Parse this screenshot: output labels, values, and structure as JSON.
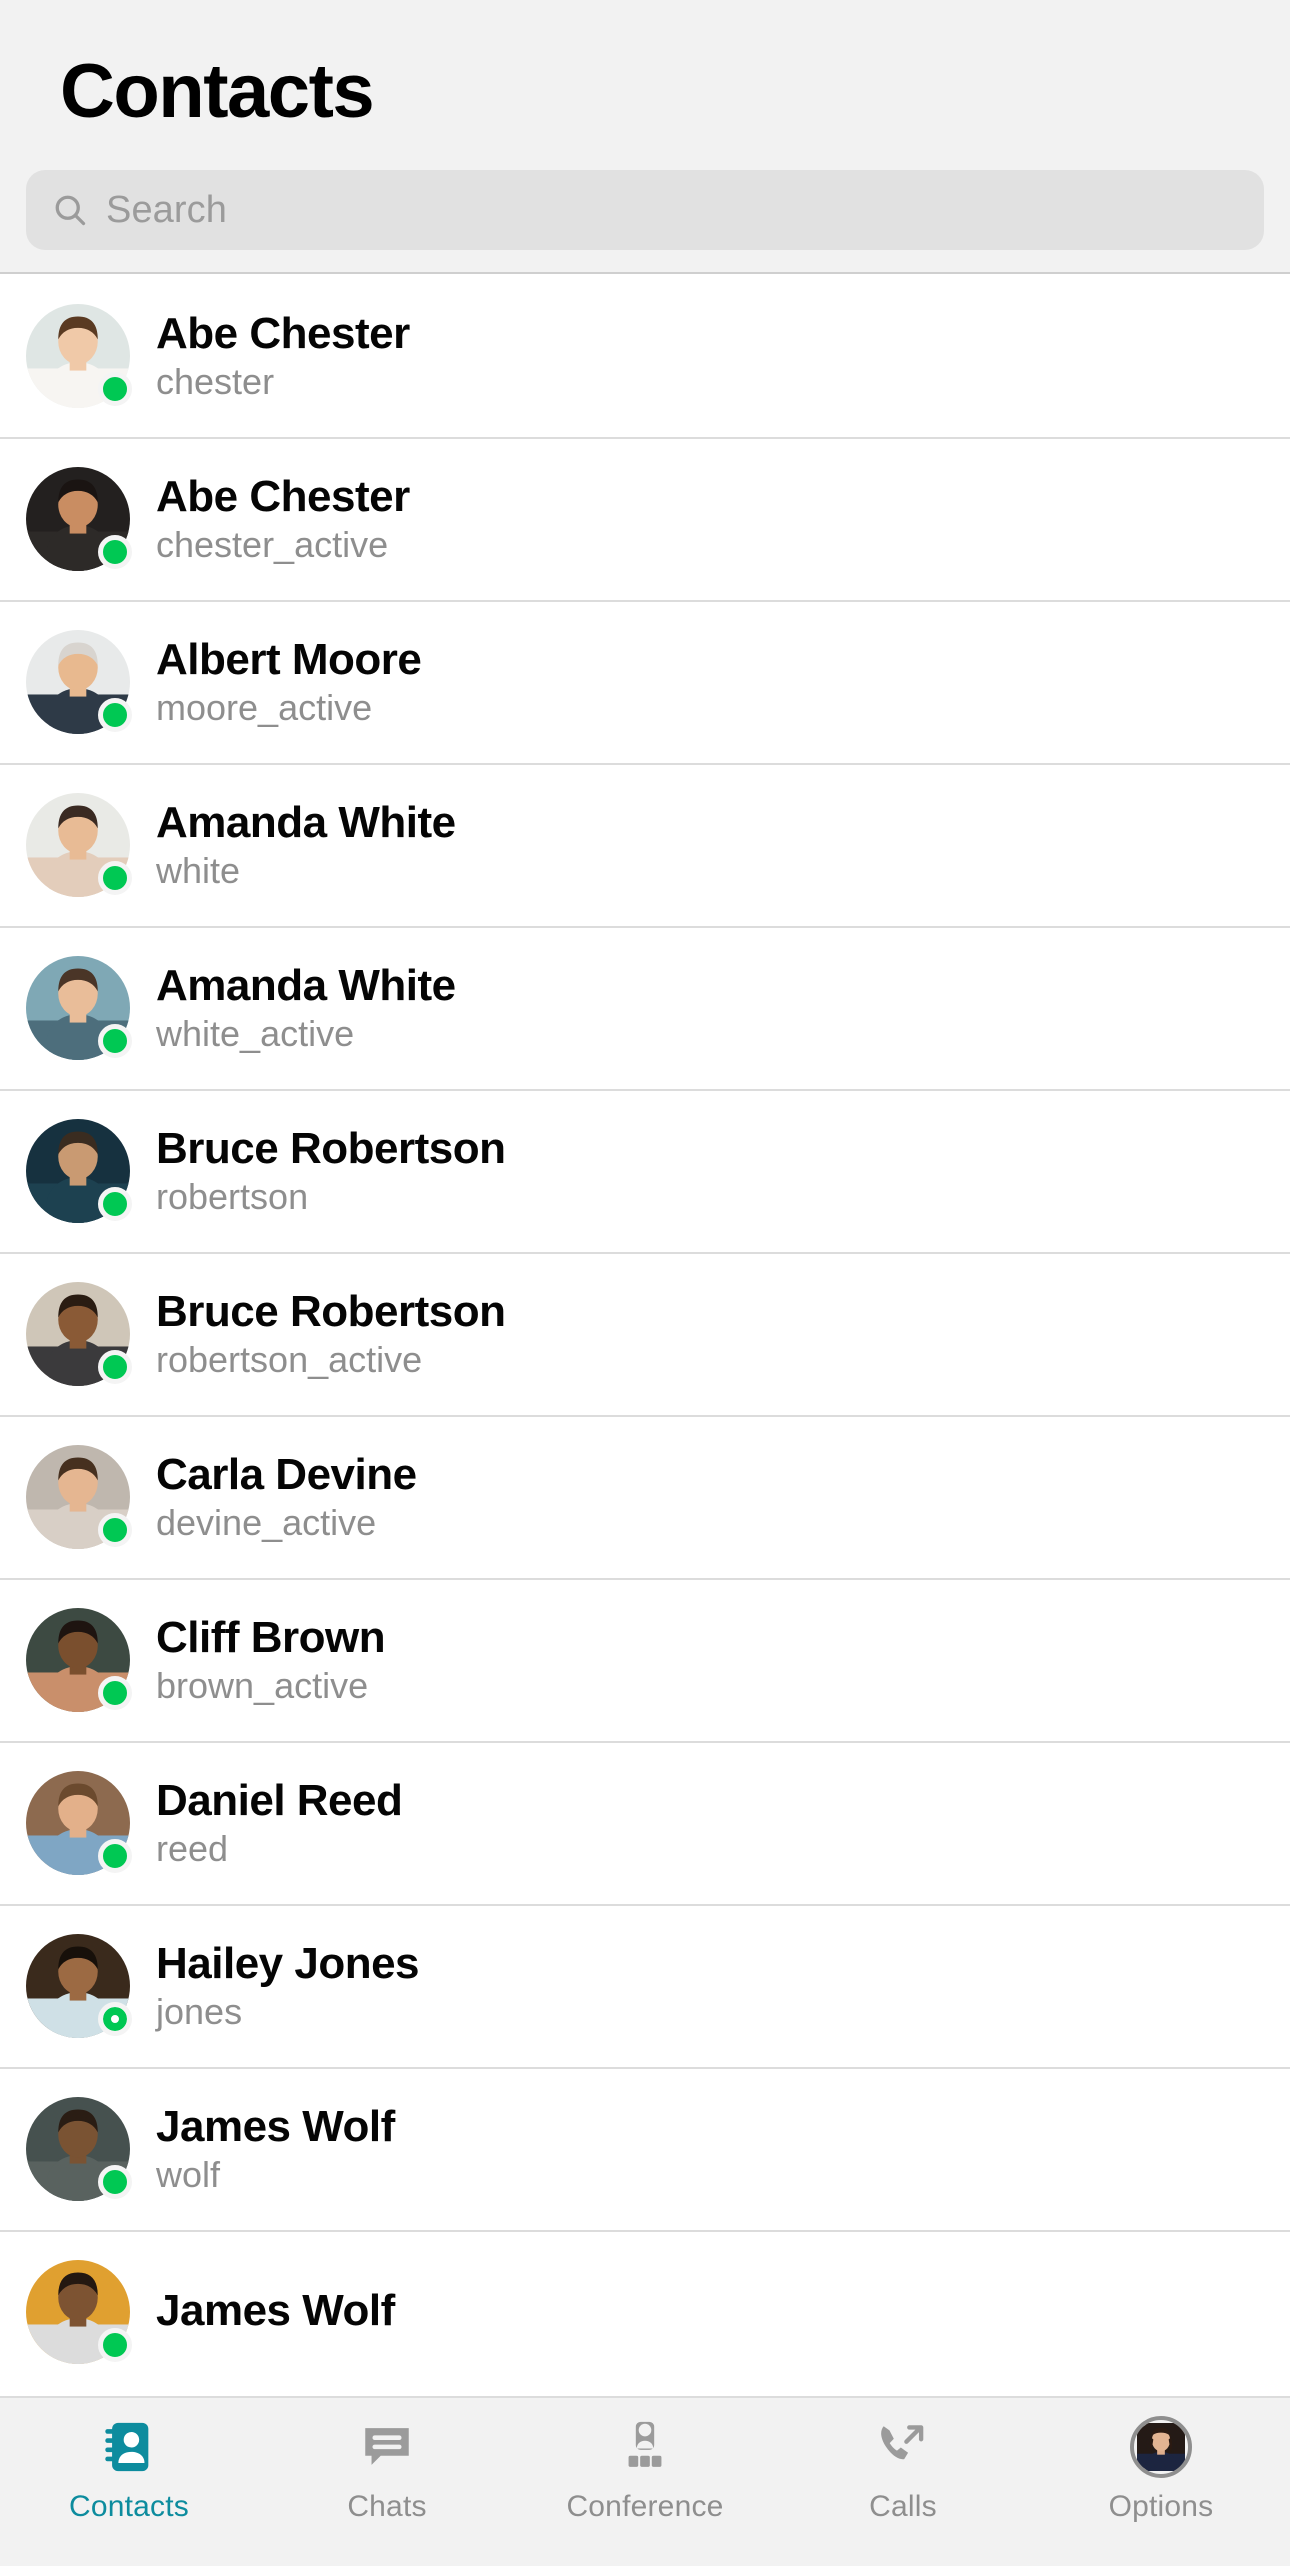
{
  "header": {
    "title": "Contacts",
    "search": {
      "placeholder": "Search",
      "value": "",
      "icon": "search-icon"
    }
  },
  "colors": {
    "accent": "#0d8c9e",
    "status_online": "#00c853",
    "status_away_ring": "#00c853",
    "title_text": "#000000",
    "username_text": "#8e8e8e",
    "search_bg": "#e1e1e1",
    "tabbar_bg": "#f2f2f2",
    "row_bg": "#ffffff",
    "separator": "#dcdcdc"
  },
  "contacts": [
    {
      "name": "Abe Chester",
      "username": "chester",
      "status": "online",
      "avatar": {
        "bg": "#dfe6e4",
        "skin": "#f0c9a8",
        "hair": "#5a3a22",
        "shirt": "#f7f5f2"
      }
    },
    {
      "name": "Abe Chester",
      "username": "chester_active",
      "status": "online",
      "avatar": {
        "bg": "#23201f",
        "skin": "#c98d62",
        "hair": "#1a1412",
        "shirt": "#2d2a28"
      }
    },
    {
      "name": "Albert Moore",
      "username": "moore_active",
      "status": "online",
      "avatar": {
        "bg": "#e8eaea",
        "skin": "#e8b98f",
        "hair": "#d8d4cf",
        "shirt": "#2e3a47"
      }
    },
    {
      "name": "Amanda White",
      "username": "white",
      "status": "online",
      "avatar": {
        "bg": "#e9eae6",
        "skin": "#e8bb95",
        "hair": "#3a2a22",
        "shirt": "#e3cdbb"
      }
    },
    {
      "name": "Amanda White",
      "username": "white_active",
      "status": "online",
      "avatar": {
        "bg": "#7fa8b5",
        "skin": "#e9bd99",
        "hair": "#4a3527",
        "shirt": "#4d6e7c"
      }
    },
    {
      "name": "Bruce Robertson",
      "username": "robertson",
      "status": "online",
      "avatar": {
        "bg": "#16313f",
        "skin": "#c99a72",
        "hair": "#3a2c20",
        "shirt": "#1d4150"
      }
    },
    {
      "name": "Bruce Robertson",
      "username": "robertson_active",
      "status": "online",
      "avatar": {
        "bg": "#cfc6b8",
        "skin": "#8a5a36",
        "hair": "#2a1c12",
        "shirt": "#3b3a3c"
      }
    },
    {
      "name": "Carla Devine",
      "username": "devine_active",
      "status": "online",
      "avatar": {
        "bg": "#bfb7ae",
        "skin": "#e5b691",
        "hair": "#46301f",
        "shirt": "#d8cfc6"
      }
    },
    {
      "name": "Cliff Brown",
      "username": "brown_active",
      "status": "online",
      "avatar": {
        "bg": "#3d4a42",
        "skin": "#7a4f2e",
        "hair": "#1e1410",
        "shirt": "#c98f6b"
      }
    },
    {
      "name": "Daniel Reed",
      "username": "reed",
      "status": "online",
      "avatar": {
        "bg": "#8d6a4f",
        "skin": "#e3b08a",
        "hair": "#6b4a2e",
        "shirt": "#7fa6c4"
      }
    },
    {
      "name": "Hailey Jones",
      "username": "jones",
      "status": "away",
      "avatar": {
        "bg": "#3a2a1c",
        "skin": "#9c6a43",
        "hair": "#17100a",
        "shirt": "#cfe0e6"
      }
    },
    {
      "name": "James Wolf",
      "username": "wolf",
      "status": "online",
      "avatar": {
        "bg": "#46514f",
        "skin": "#7a5333",
        "hair": "#2a1d14",
        "shirt": "#59625f"
      }
    },
    {
      "name": "James Wolf",
      "username": "",
      "status": "online",
      "avatar": {
        "bg": "#e0a030",
        "skin": "#7d5332",
        "hair": "#241811",
        "shirt": "#dcdcdc"
      }
    }
  ],
  "tabbar": {
    "items": [
      {
        "label": "Contacts",
        "icon": "contact-card-icon",
        "active": true
      },
      {
        "label": "Chats",
        "icon": "chat-bubble-icon",
        "active": false
      },
      {
        "label": "Conference",
        "icon": "conference-icon",
        "active": false
      },
      {
        "label": "Calls",
        "icon": "outgoing-call-icon",
        "active": false
      },
      {
        "label": "Options",
        "icon": "user-avatar-icon",
        "active": false
      }
    ]
  }
}
